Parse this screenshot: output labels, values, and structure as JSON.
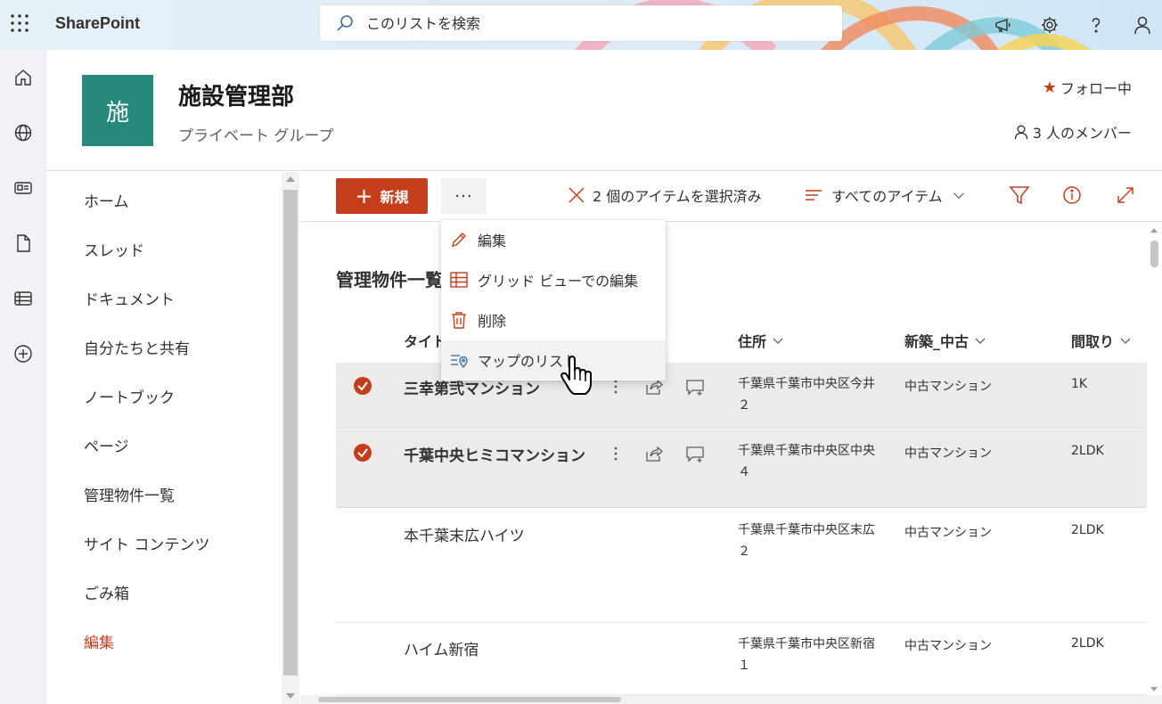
{
  "suite": {
    "brand": "SharePoint",
    "search_placeholder": "このリストを検索"
  },
  "site": {
    "logo_char": "施",
    "title": "施設管理部",
    "subtitle": "プライベート グループ",
    "follow_label": "フォロー中",
    "members_label": "3 人のメンバー",
    "accent_color": "#c43e1c",
    "logo_color": "#26897a"
  },
  "nav": {
    "items": [
      "ホーム",
      "スレッド",
      "ドキュメント",
      "自分たちと共有",
      "ノートブック",
      "ページ",
      "管理物件一覧",
      "サイト コンテンツ",
      "ごみ箱"
    ],
    "edit_label": "編集"
  },
  "command": {
    "new_label": "新規",
    "more_label": "···",
    "selection_label": "2 個のアイテムを選択済み",
    "view_label": "すべてのアイテム"
  },
  "menu": {
    "items": [
      {
        "label": "編集",
        "icon": "pencil-icon"
      },
      {
        "label": "グリッド ビューでの編集",
        "icon": "grid-icon"
      },
      {
        "label": "削除",
        "icon": "trash-icon"
      },
      {
        "label": "マップのリスト",
        "icon": "map-list-icon"
      }
    ]
  },
  "list": {
    "title": "管理物件一覧",
    "columns": {
      "title": "タイトル",
      "address": "住所",
      "kind": "新築_中古",
      "layout": "間取り"
    },
    "rows": [
      {
        "title": "三幸第弐マンション",
        "address": "千葉県千葉市中央区今井２",
        "kind": "中古マンション",
        "layout": "1K",
        "selected": true
      },
      {
        "title": "千葉中央ヒミコマンション",
        "address": "千葉県千葉市中央区中央４",
        "kind": "中古マンション",
        "layout": "2LDK",
        "selected": true
      },
      {
        "title": "本千葉末広ハイツ",
        "address": "千葉県千葉市中央区末広２",
        "kind": "中古マンション",
        "layout": "2LDK",
        "selected": false
      },
      {
        "title": "ハイム新宿",
        "address": "千葉県千葉市中央区新宿１",
        "kind": "中古マンション",
        "layout": "2LDK",
        "selected": false
      }
    ]
  }
}
